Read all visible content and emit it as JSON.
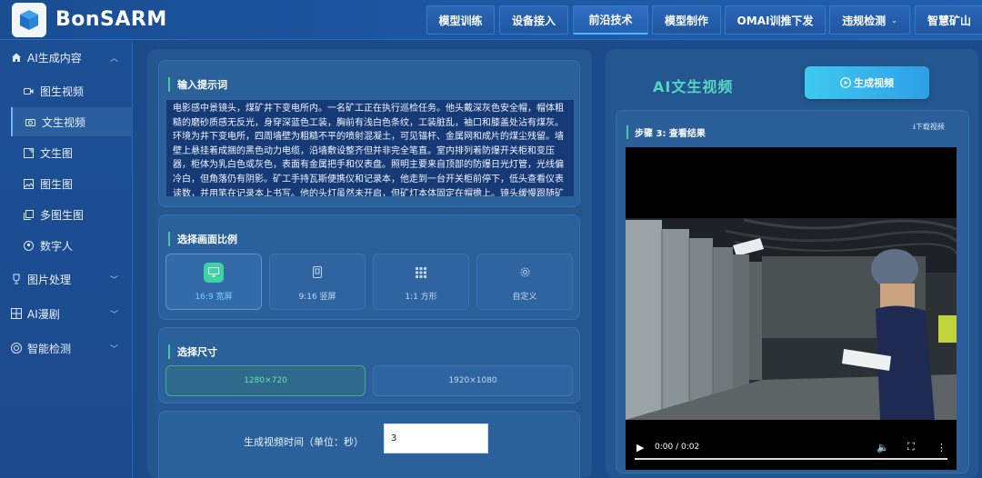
{
  "brand": {
    "name": "BonSARM"
  },
  "nav": [
    {
      "label": "模型训练"
    },
    {
      "label": "设备接入"
    },
    {
      "label": "前沿技术",
      "active": true
    },
    {
      "label": "模型制作"
    },
    {
      "label": "OMAI训推下发"
    },
    {
      "label": "违规检测",
      "has_dropdown": true
    },
    {
      "label": "智慧矿山"
    }
  ],
  "sidebar": {
    "group_ai": {
      "label": "AI生成内容",
      "icon": "home-icon"
    },
    "items": [
      {
        "label": "图生视频",
        "icon": "video-icon"
      },
      {
        "label": "文生视频",
        "icon": "camera-icon",
        "active": true
      },
      {
        "label": "文生图",
        "icon": "edit-image-icon"
      },
      {
        "label": "图生图",
        "icon": "image-icon"
      },
      {
        "label": "多图生图",
        "icon": "multi-image-icon"
      },
      {
        "label": "数字人",
        "icon": "person-icon"
      }
    ],
    "group_image": {
      "label": "图片处理",
      "icon": "trophy-icon"
    },
    "group_comic": {
      "label": "AI漫剧",
      "icon": "grid-icon"
    },
    "group_detect": {
      "label": "智能检测",
      "icon": "target-icon"
    }
  },
  "prompt": {
    "title": "输入提示词",
    "text": "电影感中景镜头，煤矿井下变电所内。一名矿工正在执行巡检任务。他头戴深灰色安全帽，帽体粗糙的磨砂质感无反光，身穿深蓝色工装，胸前有浅白色条纹，工装脏乱，袖口和膝盖处沾有煤灰。环境为井下变电所，四周墙壁为粗糙不平的喷射混凝土，可见锚杆、金属网和成片的煤尘残留。墙壁上悬挂着成捆的黑色动力电缆，沿墙敷设整齐但并非完全笔直。室内排列着防爆开关柜和变压器，柜体为乳白色或灰色，表面有金属把手和仪表盘。照明主要来自顶部的防爆日光灯管，光线偏冷白，但角落仍有阴影。矿工手持瓦斯便携仪和记录本，他走到一台开关柜前停下，低头查看仪表读数，并用笔在记录本上书写。他的头灯虽然未开启，但矿灯本体固定在帽檐上。镜头缓慢跟随矿工移动，先展示变电所的整体环境，随后推近至矿工手部和仪表读数，画面真实自然，色调偏冷。"
  },
  "ratio": {
    "title": "选择画面比例",
    "options": [
      {
        "label": "16:9 宽屏",
        "icon": "monitor-icon",
        "active": true
      },
      {
        "label": "9:16 竖屏",
        "icon": "tablet-icon"
      },
      {
        "label": "1:1 方形",
        "icon": "grid-dots-icon"
      },
      {
        "label": "自定义",
        "icon": "gear-icon"
      }
    ]
  },
  "size": {
    "title": "选择尺寸",
    "options": [
      {
        "label": "1280×720",
        "active": true
      },
      {
        "label": "1920×1080"
      }
    ]
  },
  "duration": {
    "label": "生成视频时间（单位：秒）",
    "value": "3"
  },
  "result": {
    "title": "AI文生视频",
    "generate_label": "生成视频",
    "step_title": "步骤 3: 查看结果",
    "download_label": "下载视频",
    "player": {
      "time": "0:00 / 0:02",
      "progress": 0
    }
  },
  "colors": {
    "accent_teal": "#55d6c4",
    "active_green": "#3fd3a4",
    "button_blue": "#3ec9f0"
  }
}
